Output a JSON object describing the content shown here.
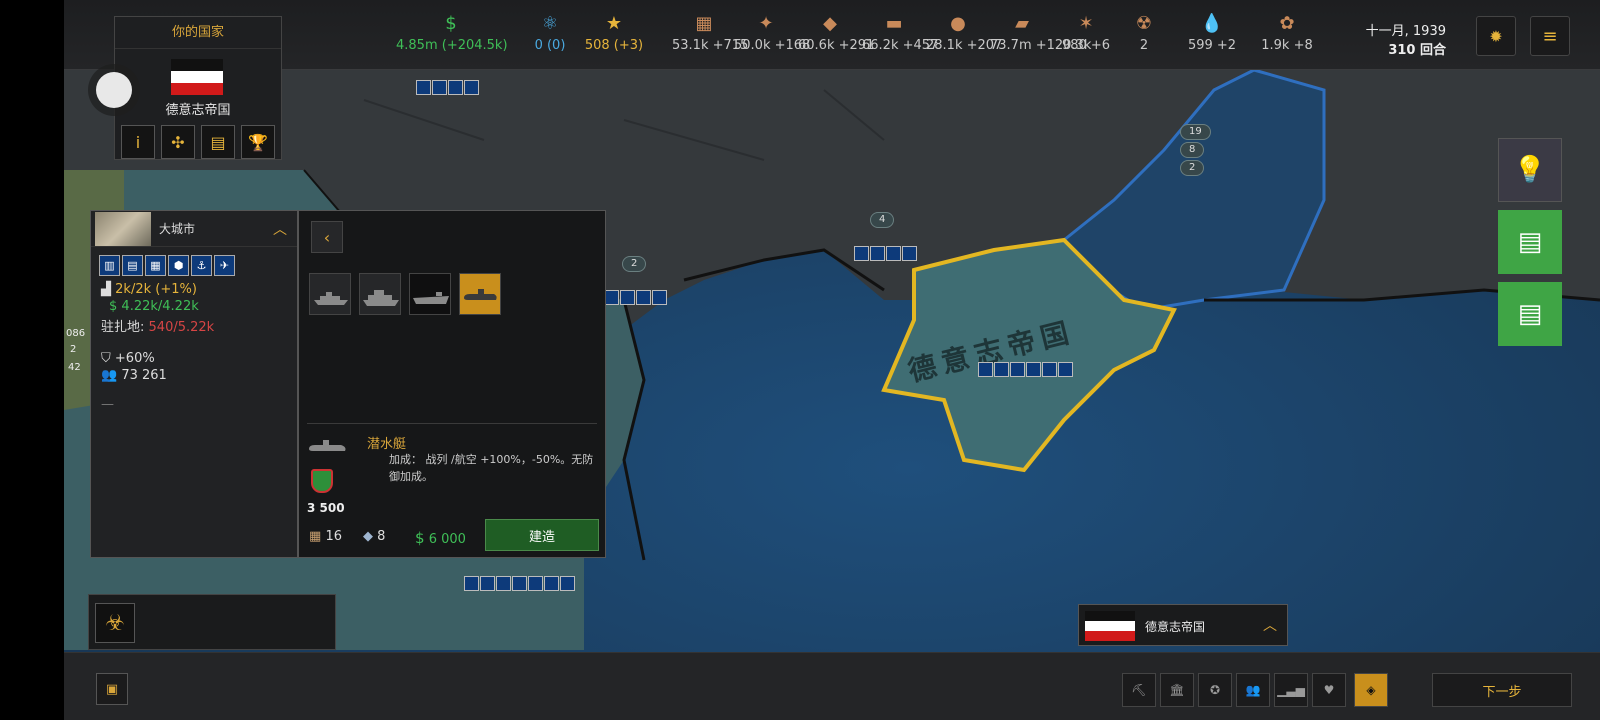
{
  "topbar": {
    "resources": [
      {
        "icon": "dollar-icon",
        "glyph": "$",
        "value": "4.85m (+204.5k)",
        "color": "#3fbf57"
      },
      {
        "icon": "atom-icon",
        "glyph": "⚛",
        "value": "0 (0)",
        "color": "#4aa9e0"
      },
      {
        "icon": "star-icon",
        "glyph": "★",
        "value": "508 (+3)",
        "color": "#e6b43b"
      },
      {
        "icon": "wood-icon",
        "glyph": "▦",
        "value": "53.1k +715",
        "color": "#c9c9c9"
      },
      {
        "icon": "stone-icon",
        "glyph": "✦",
        "value": "50.0k +168",
        "color": "#c9c9c9"
      },
      {
        "icon": "iron-icon",
        "glyph": "◆",
        "value": "60.6k +291",
        "color": "#c9c9c9"
      },
      {
        "icon": "gold-icon",
        "glyph": "▬",
        "value": "66.2k +457",
        "color": "#c9c9c9"
      },
      {
        "icon": "coal-icon",
        "glyph": "●",
        "value": "28.1k +207",
        "color": "#c9c9c9"
      },
      {
        "icon": "ammo-icon",
        "glyph": "▰",
        "value": "73.7m +120.3k",
        "color": "#c9c9c9"
      },
      {
        "icon": "rare-icon",
        "glyph": "✶",
        "value": "980 +6",
        "color": "#c9c9c9"
      },
      {
        "icon": "uranium-icon",
        "glyph": "☢",
        "value": "2",
        "color": "#c9c9c9"
      },
      {
        "icon": "oil-icon",
        "glyph": "💧",
        "value": "599 +2",
        "color": "#c9c9c9"
      },
      {
        "icon": "food-icon",
        "glyph": "✿",
        "value": "1.9k +8",
        "color": "#c9c9c9"
      }
    ],
    "date": "十一月, 1939",
    "turn": "310 回合",
    "bug_icon": "bug-icon",
    "menu_icon": "menu-icon"
  },
  "country_panel": {
    "title": "你的国家",
    "name": "德意志帝国",
    "flag_colors": [
      "#111111",
      "#ffffff",
      "#d11a1a"
    ],
    "buttons": [
      "info-icon",
      "tech-icon",
      "policy-icon",
      "trophy-icon"
    ],
    "button_glyphs": [
      "i",
      "✣",
      "▤",
      "🏆"
    ]
  },
  "city_panel": {
    "name": "大城市",
    "production": "2k/2k (+1%)",
    "money": "4.22k/4.22k",
    "garrison_label": "驻扎地:",
    "garrison_value": "540/5.22k",
    "defense": "+60%",
    "population": "73 261",
    "dash": "—",
    "building_glyphs": [
      "▥",
      "▤",
      "▦",
      "⬢",
      "⚓",
      "✈"
    ]
  },
  "build_panel": {
    "unit_name": "潜水艇",
    "description": "加成： 战列 /航空 +100%，-50%。无防御加成。",
    "hp": "3 500",
    "cost_wood": "16",
    "cost_iron": "8",
    "cost_money": "6 000",
    "build_label": "建造"
  },
  "map": {
    "country_label": "德意志帝国",
    "pill_values": [
      "19",
      "8",
      "2",
      "4",
      "2"
    ],
    "left_edge_numbers": [
      "086",
      "2",
      "42"
    ]
  },
  "selected_country": {
    "name": "德意志帝国"
  },
  "bottombar": {
    "next_label": "下一步",
    "tabs": [
      {
        "icon": "pickaxe-icon",
        "glyph": "⛏"
      },
      {
        "icon": "bank-icon",
        "glyph": "🏛"
      },
      {
        "icon": "diplomacy-icon",
        "glyph": "✪"
      },
      {
        "icon": "people-icon",
        "glyph": "👥"
      },
      {
        "icon": "chart-icon",
        "glyph": "▁▃▅"
      },
      {
        "icon": "heart-icon",
        "glyph": "♥"
      },
      {
        "icon": "layers-icon",
        "glyph": "◈"
      }
    ]
  }
}
